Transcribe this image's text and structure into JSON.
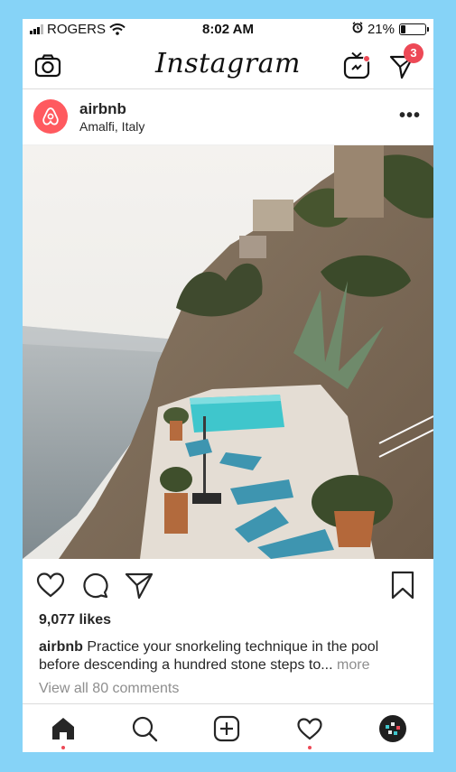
{
  "status_bar": {
    "carrier": "ROGERS",
    "time": "8:02 AM",
    "battery_percent": "21%",
    "battery_level": 0.21
  },
  "nav": {
    "logo_text": "Instagram",
    "direct_badge_count": "3",
    "icons": [
      "camera-icon",
      "igtv-icon",
      "direct-message-icon"
    ],
    "accent_color": "#ed4956"
  },
  "post": {
    "username": "airbnb",
    "location": "Amalfi, Italy",
    "more_label": "•••",
    "brand_color": "#ff5a5f",
    "image_icon": "cliffside-pool-photo",
    "likes": "9,077 likes",
    "caption_user": "airbnb",
    "caption_text": "Practice your snorkeling technique in the pool before descending a hundred stone steps to...",
    "caption_more": "more",
    "comments_link": "View all 80 comments"
  },
  "actions": {
    "icons": [
      "heart-icon",
      "comment-icon",
      "share-icon",
      "bookmark-icon"
    ]
  },
  "tab_bar": {
    "icons": [
      "home-icon",
      "search-icon",
      "add-post-icon",
      "activity-heart-icon",
      "profile-avatar"
    ]
  }
}
